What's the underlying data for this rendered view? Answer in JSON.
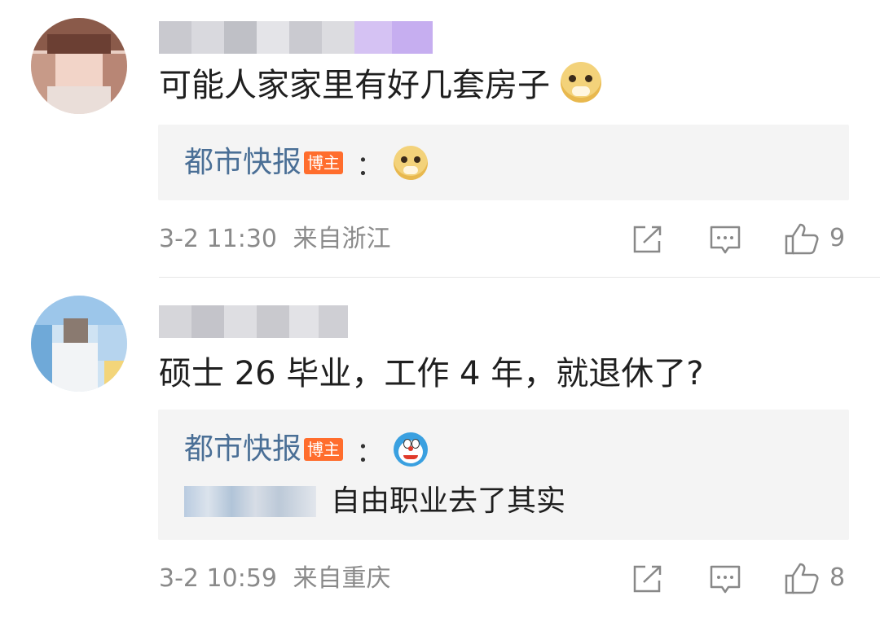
{
  "comments": [
    {
      "text": "可能人家家里有好几套房子",
      "text_emoji": "doge-emoji",
      "reply": {
        "author": "都市快报",
        "badge": "博主",
        "colon": "：",
        "emoji": "doge-emoji"
      },
      "time": "3-2 11:30",
      "location": "来自浙江",
      "likes": "9"
    },
    {
      "text": "硕士 26 毕业，工作 4 年，就退休了?",
      "reply": {
        "author": "都市快报",
        "badge": "博主",
        "colon": "：",
        "emoji": "doraemon-emoji",
        "text": "自由职业去了其实"
      },
      "time": "3-2 10:59",
      "location": "来自重庆",
      "likes": "8"
    }
  ],
  "icons": {
    "share": "share-icon",
    "comment": "comment-icon",
    "like": "thumbs-up-icon"
  }
}
